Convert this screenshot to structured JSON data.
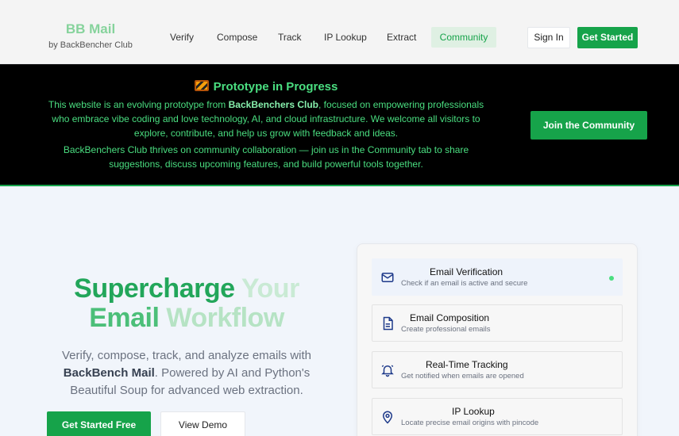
{
  "brand": {
    "title": "BB Mail",
    "subtitle": "by BackBencher Club"
  },
  "nav": {
    "items": [
      {
        "label": "Verify"
      },
      {
        "label": "Compose"
      },
      {
        "label": "Track"
      },
      {
        "label": "IP Lookup"
      },
      {
        "label": "Extract"
      },
      {
        "label": "Community",
        "active": true
      }
    ],
    "signin_label": "Sign In",
    "getstarted_label": "Get Started"
  },
  "banner": {
    "title": "Prototype in Progress",
    "icon": "construction-barrier-icon",
    "p1_pre": "This website is an evolving prototype from ",
    "p1_bold": "BackBenchers Club",
    "p1_post": ", focused on empowering professionals who embrace vibe coding and love technology, AI, and cloud infrastructure. We welcome all visitors to explore, contribute, and help us grow with feedback and ideas.",
    "p2": "BackBenchers Club thrives on community collaboration — join us in the Community tab to share suggestions, discuss upcoming features, and build powerful tools together.",
    "join_label": "Join the Community"
  },
  "hero": {
    "title_line1_a": "Supercharge",
    "title_line1_b": "Your",
    "title_line2_a": "Email",
    "title_line2_b": "Workflow",
    "desc_pre": "Verify, compose, track, and analyze emails with ",
    "desc_bold": "BackBench Mail",
    "desc_post": ". Powered by AI and Python's Beautiful Soup for advanced web extraction.",
    "primary_label": "Get Started Free",
    "secondary_label": "View Demo"
  },
  "features": [
    {
      "title": "Email Verification",
      "desc": "Check if an email is active and secure",
      "icon": "mail-icon",
      "active": true
    },
    {
      "title": "Email Composition",
      "desc": "Create professional emails",
      "icon": "document-icon"
    },
    {
      "title": "Real-Time Tracking",
      "desc": "Get notified when emails are opened",
      "icon": "bell-icon"
    },
    {
      "title": "IP Lookup",
      "desc": "Locate precise email origins with pincode",
      "icon": "location-pin-icon"
    }
  ],
  "colors": {
    "accent": "#16a34a",
    "banner_bg": "#000000",
    "banner_text": "#4ade80"
  }
}
